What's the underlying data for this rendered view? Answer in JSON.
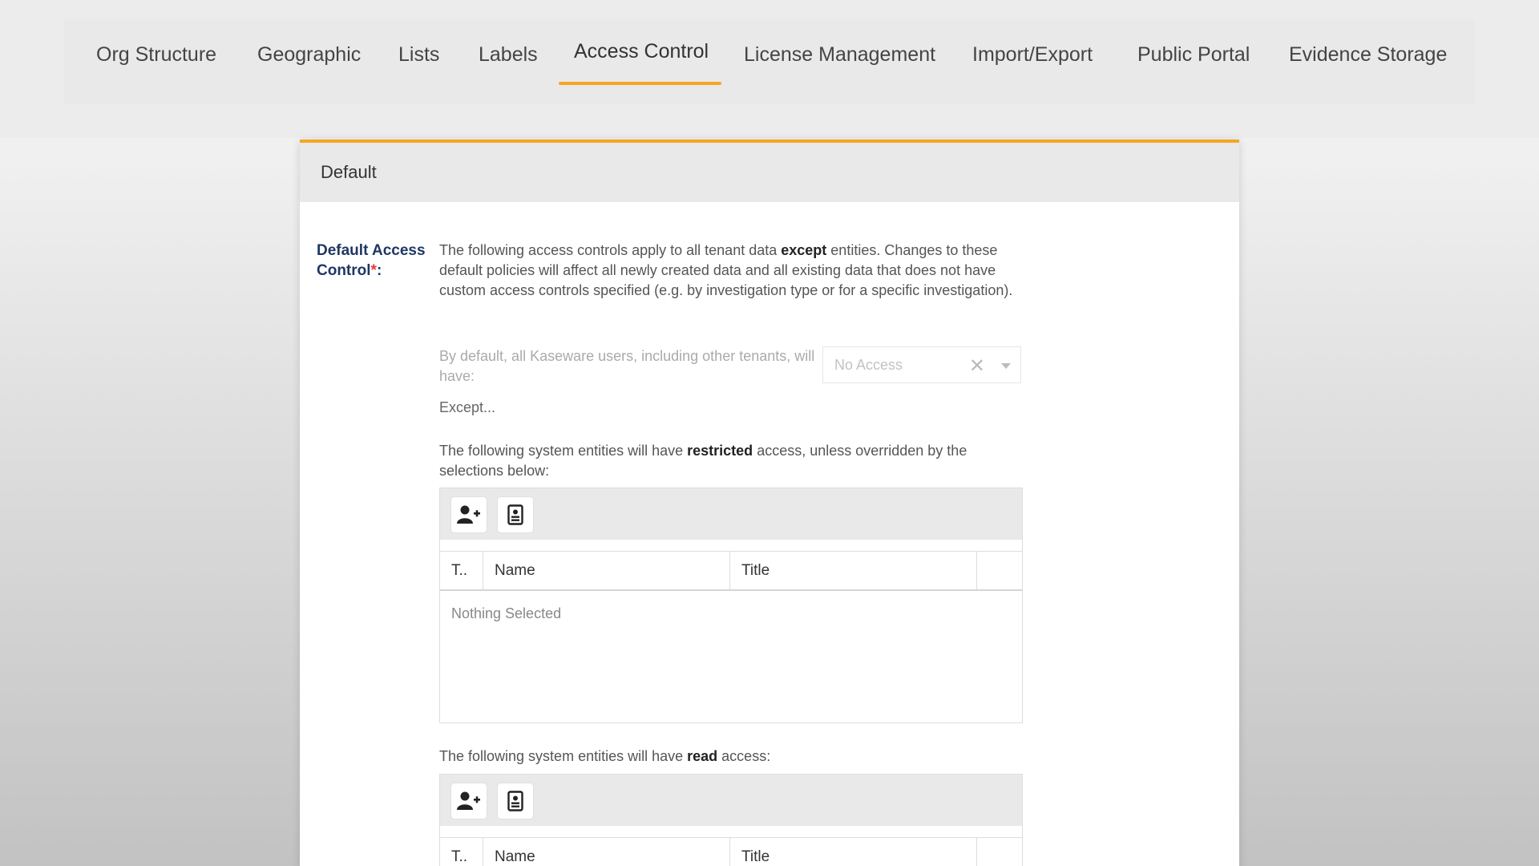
{
  "nav": {
    "tabs": [
      {
        "label": "Org Structure"
      },
      {
        "label": "Geographic"
      },
      {
        "label": "Lists"
      },
      {
        "label": "Labels"
      },
      {
        "label": "Access Control",
        "active": true
      },
      {
        "label": "License Management"
      },
      {
        "label": "Import/Export"
      },
      {
        "label": "Public Portal"
      },
      {
        "label": "Evidence Storage"
      }
    ]
  },
  "panel": {
    "title": "Default",
    "field_label": "Default Access Control",
    "required_mark": "*",
    "label_colon": ":",
    "description_1": "The following access controls apply to all tenant data ",
    "description_bold": "except",
    "description_2": " entities. Changes to these default policies will affect all newly created data and all existing data that does not have custom access controls specified (e.g. by investigation type or for a specific investigation).",
    "default_prompt": "By default, all Kaseware users, including other tenants, will have:",
    "default_select": {
      "value": "No Access",
      "clear": "✕"
    },
    "except_label": "Except...",
    "restricted": {
      "text_1": "The following system entities will have ",
      "text_bold": "restricted",
      "text_2": " access, unless overridden by the selections below:",
      "columns": [
        "T..",
        "Name",
        "Title"
      ],
      "empty": "Nothing Selected"
    },
    "read": {
      "text_1": "The following system entities will have ",
      "text_bold": "read",
      "text_2": " access:",
      "columns": [
        "T..",
        "Name",
        "Title"
      ]
    }
  },
  "colors": {
    "accent": "#f5a623",
    "label": "#1f3763",
    "required": "#e53935"
  },
  "icons": [
    "add-user-icon",
    "contact-card-icon"
  ]
}
